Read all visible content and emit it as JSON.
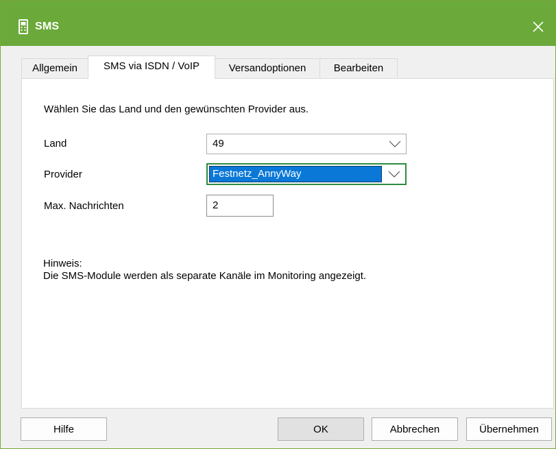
{
  "window": {
    "title": "SMS",
    "title_icon": "phone-icon",
    "close_icon": "close-icon",
    "accent": "#6aa93a"
  },
  "tabs": [
    {
      "label": "Allgemein",
      "active": false
    },
    {
      "label": "SMS via ISDN / VoIP",
      "active": true
    },
    {
      "label": "Versandoptionen",
      "active": false
    },
    {
      "label": "Bearbeiten",
      "active": false
    }
  ],
  "panel": {
    "intro": "Wählen Sie das Land und den gewünschten Provider aus.",
    "land": {
      "label": "Land",
      "value": "49"
    },
    "provider": {
      "label": "Provider",
      "value": "Festnetz_AnnyWay"
    },
    "max_messages": {
      "label": "Max. Nachrichten",
      "value": "2"
    },
    "hint_title": "Hinweis:",
    "hint_text": "Die SMS-Module werden als separate Kanäle im Monitoring angezeigt."
  },
  "buttons": {
    "help": "Hilfe",
    "ok": "OK",
    "cancel": "Abbrechen",
    "apply": "Übernehmen"
  }
}
